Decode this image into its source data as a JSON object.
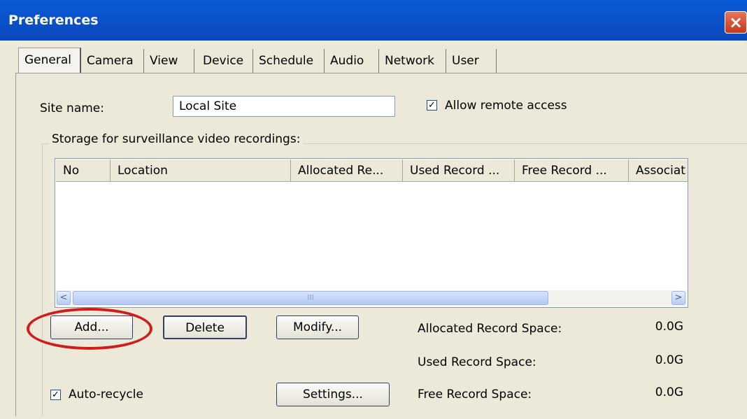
{
  "window": {
    "title": "Preferences",
    "close_glyph": "×"
  },
  "tabs": [
    {
      "label": "General"
    },
    {
      "label": "Camera"
    },
    {
      "label": "View"
    },
    {
      "label": "Device"
    },
    {
      "label": "Schedule"
    },
    {
      "label": "Audio"
    },
    {
      "label": "Network"
    },
    {
      "label": "User"
    }
  ],
  "general": {
    "site_name_label": "Site name:",
    "site_name_value": "Local Site",
    "allow_remote_label": "Allow remote access",
    "allow_remote_checked": true,
    "storage_group_label": "Storage for surveillance video recordings:",
    "columns": [
      "No",
      "Location",
      "Allocated Re...",
      "Used Record ...",
      "Free Record ...",
      "Associat"
    ],
    "scroll_left": "<",
    "scroll_right": ">",
    "scroll_grip": "III",
    "buttons": {
      "add": "Add...",
      "delete": "Delete",
      "modify": "Modify...",
      "settings": "Settings..."
    },
    "auto_recycle_label": "Auto-recycle",
    "auto_recycle_checked": true,
    "space": [
      {
        "label": "Allocated Record Space:",
        "value": "0.0G"
      },
      {
        "label": "Used Record Space:",
        "value": "0.0G"
      },
      {
        "label": "Free Record Space:",
        "value": "0.0G"
      }
    ]
  },
  "colors": {
    "titlebar": "#0a50c8",
    "dialog_bg": "#ece9d8",
    "highlight_circle": "#d01c1c"
  }
}
